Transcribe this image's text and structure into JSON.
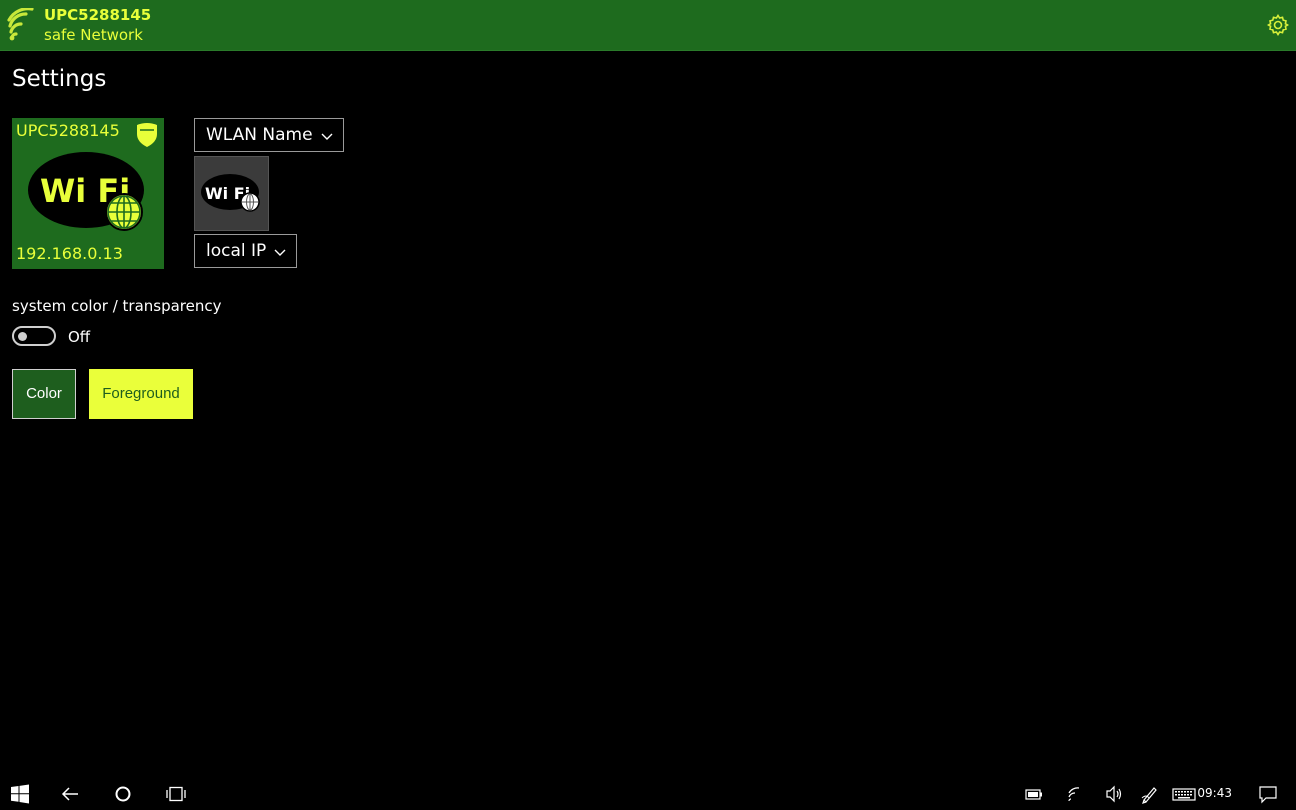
{
  "header": {
    "ssid": "UPC5288145",
    "subtitle": "safe Network"
  },
  "page": {
    "title": "Settings"
  },
  "preview_tile": {
    "ssid": "UPC5288145",
    "ip": "192.168.0.13",
    "wifi_text": "Wi Fi"
  },
  "dropdowns": {
    "top_label": "WLAN Name",
    "bottom_label": "local IP"
  },
  "toggle": {
    "label": "system color / transparency",
    "state": "Off"
  },
  "buttons": {
    "color_label": "Color",
    "foreground_label": "Foreground"
  },
  "taskbar": {
    "clock": "09:43"
  },
  "colors": {
    "accent_green": "#1e6b1e",
    "foreground_yellow": "#e8ff3a"
  },
  "icons": [
    "wifi-signal-icon",
    "settings-gear-icon",
    "shield-icon",
    "wifi-globe-icon",
    "chevron-down-icon",
    "windows-start-icon",
    "back-arrow-icon",
    "cortana-circle-icon",
    "task-view-icon",
    "battery-icon",
    "network-icon",
    "volume-icon",
    "pen-icon",
    "keyboard-icon",
    "notifications-icon"
  ]
}
